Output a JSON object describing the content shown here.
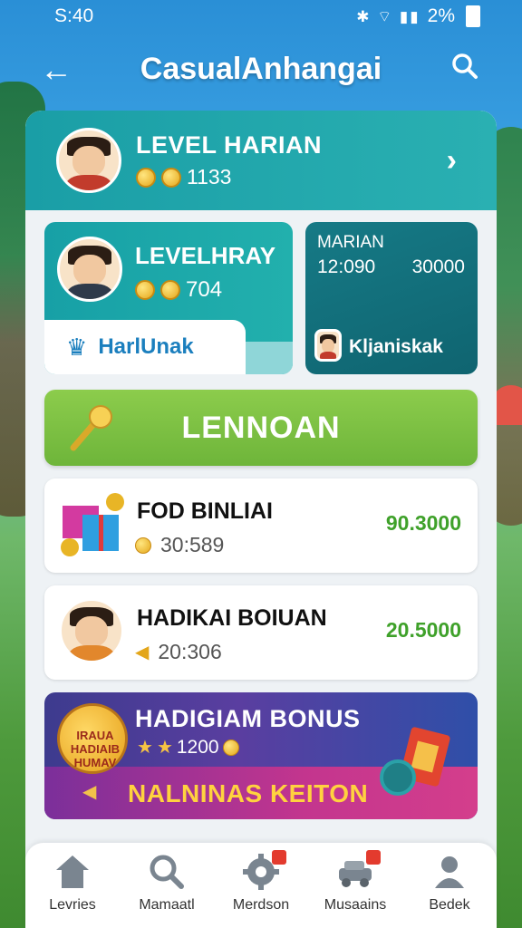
{
  "status_bar": {
    "time": "S:40",
    "icons": "✱ ⌔ ▮▮",
    "battery": "2%"
  },
  "header": {
    "title": "CasualAnhangai",
    "back_icon": "arrow-left-icon",
    "search_icon": "search-icon"
  },
  "top_card": {
    "title": "LEVEL HARIAN",
    "coins": "1133"
  },
  "mid_left": {
    "title": "LEVELHRAY",
    "coins": "704",
    "tab_label": "HarlUnak"
  },
  "mid_right": {
    "label": "MARIAN",
    "time": "12:090",
    "value": "30000",
    "name": "Kljaniskak"
  },
  "action_button": {
    "label": "LENNOAN"
  },
  "list": [
    {
      "name": "FOD BINLIAI",
      "sub": "30:589",
      "amount": "90.3000"
    },
    {
      "name": "HADIKAI  BOIUAN",
      "sub": "20:306",
      "amount": "20.5000"
    }
  ],
  "promo": {
    "title": "HADIGIAM BONUS",
    "value": "1200",
    "cta": "NALNINAS KEITON",
    "badge_text": "IRAUA HADIAIB HUMAV"
  },
  "bottom_nav": [
    {
      "label": "Levries",
      "icon": "home-icon"
    },
    {
      "label": "Mamaatl",
      "icon": "search-icon"
    },
    {
      "label": "Merdson",
      "icon": "gear-icon"
    },
    {
      "label": "Musaains",
      "icon": "car-icon"
    },
    {
      "label": "Bedek",
      "icon": "profile-icon"
    }
  ],
  "colors": {
    "teal": "#1a9ea6",
    "green": "#6eb53a",
    "amount_green": "#3fa12a",
    "promo_purple": "#5a3ea0",
    "cta_yellow": "#ffd23f"
  }
}
